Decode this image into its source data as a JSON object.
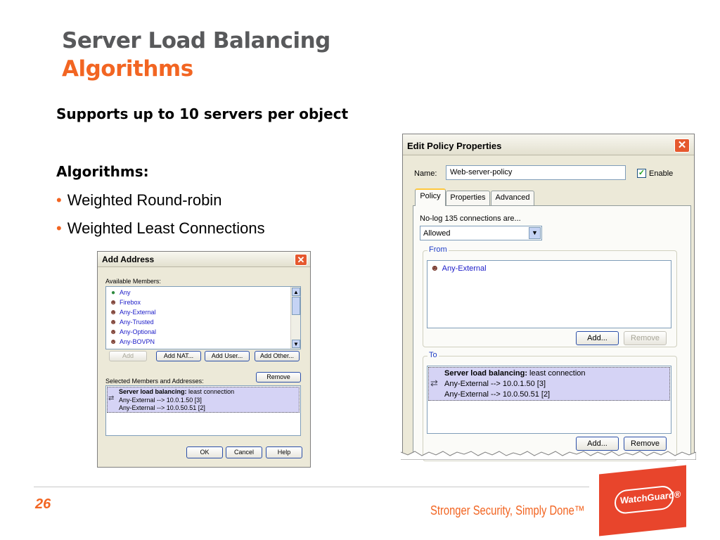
{
  "slide": {
    "title_line1": "Server Load Balancing",
    "title_line2": "Algorithms",
    "subheading": "Supports up to 10 servers per object",
    "algorithms_heading": "Algorithms:",
    "bullets": [
      "Weighted Round-robin",
      "Weighted Least Connections"
    ],
    "page_number": "26",
    "tagline": "Stronger Security, Simply Done™",
    "logo_text": "WatchGuard®",
    "accent_color": "#f26522",
    "title_color": "#58595b"
  },
  "add_dialog": {
    "title": "Add Address",
    "available_label": "Available Members:",
    "members": [
      {
        "label": "Any",
        "icon": "globe-icon"
      },
      {
        "label": "Firebox",
        "icon": "user-alias-icon"
      },
      {
        "label": "Any-External",
        "icon": "user-alias-icon"
      },
      {
        "label": "Any-Trusted",
        "icon": "user-alias-icon"
      },
      {
        "label": "Any-Optional",
        "icon": "user-alias-icon"
      },
      {
        "label": "Any-BOVPN",
        "icon": "user-alias-icon"
      }
    ],
    "buttons": {
      "add": "Add",
      "add_nat": "Add NAT...",
      "add_user": "Add User...",
      "add_other": "Add Other...",
      "remove": "Remove",
      "ok": "OK",
      "cancel": "Cancel",
      "help": "Help"
    },
    "selected_label": "Selected Members and Addresses:",
    "selected": {
      "heading_bold": "Server load balancing:",
      "heading_rest": " least connection",
      "lines": [
        "Any-External --> 10.0.1.50 [3]",
        "Any-External --> 10.0.50.51 [2]"
      ]
    }
  },
  "edit_dialog": {
    "title": "Edit Policy Properties",
    "name_label": "Name:",
    "name_value": "Web-server-policy",
    "enable_label": "Enable",
    "enable_checked": true,
    "tabs": [
      "Policy",
      "Properties",
      "Advanced"
    ],
    "active_tab": "Policy",
    "connections_label": "No-log 135 connections are...",
    "connections_value": "Allowed",
    "from_label": "From",
    "from_items": [
      "Any-External"
    ],
    "to_label": "To",
    "to_selected": {
      "heading_bold": "Server load balancing:",
      "heading_rest": " least connection",
      "lines": [
        "Any-External --> 10.0.1.50 [3]",
        "Any-External --> 10.0.50.51 [2]"
      ]
    },
    "buttons": {
      "from_add": "Add...",
      "from_remove": "Remove",
      "to_add": "Add...",
      "to_remove": "Remove"
    }
  }
}
